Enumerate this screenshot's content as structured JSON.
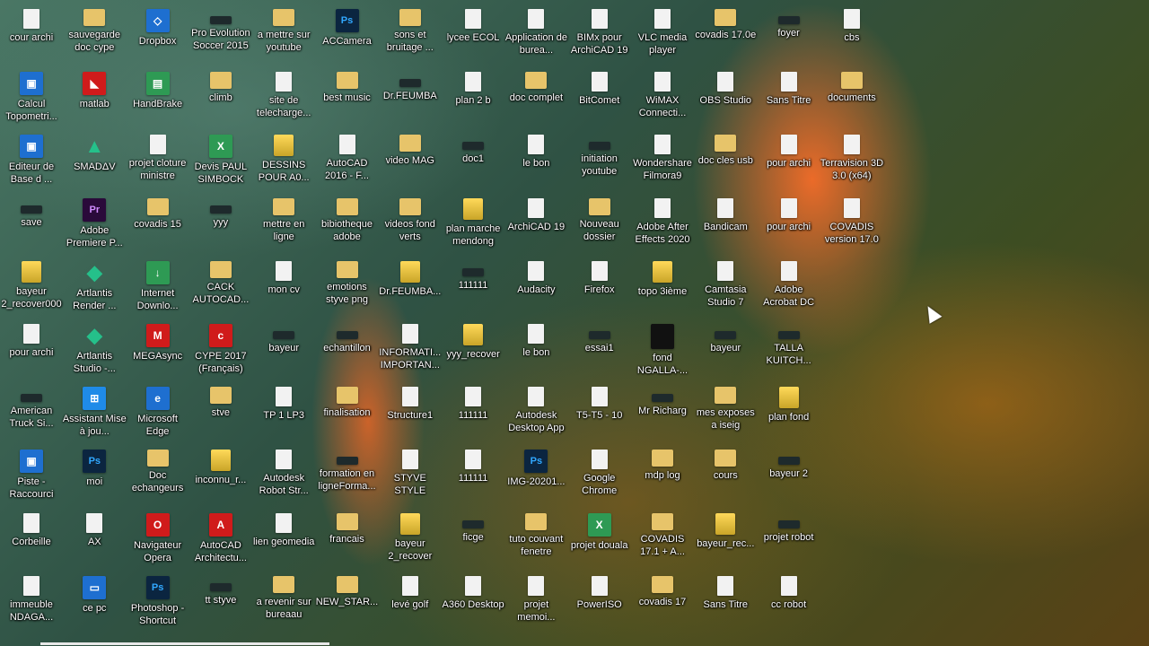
{
  "desktop": {
    "columns": [
      [
        {
          "label": "cour archi",
          "icon": "file-icon"
        },
        {
          "label": "Calcul Topometri...",
          "icon": "app-shortcut-icon"
        },
        {
          "label": "Editeur de Base d ...",
          "icon": "app-shortcut-icon"
        },
        {
          "label": "save",
          "icon": "dark-file-icon"
        },
        {
          "label": "bayeur 2_recover000",
          "icon": "dwg-file-icon"
        },
        {
          "label": "pour archi",
          "icon": "spreadsheet-icon"
        },
        {
          "label": "American Truck Si...",
          "icon": "game-icon"
        },
        {
          "label": "Piste - Raccourci",
          "icon": "app-shortcut-icon"
        },
        {
          "label": "Corbeille",
          "icon": "recycle-bin-icon"
        },
        {
          "label": "immeuble NDAGA...",
          "icon": "file-icon"
        }
      ],
      [
        {
          "label": "sauvegarde doc cype",
          "icon": "folder-icon"
        },
        {
          "label": "matlab",
          "icon": "matlab-icon"
        },
        {
          "label": "SMADΔV",
          "icon": "antivirus-icon"
        },
        {
          "label": "Adobe Premiere P...",
          "icon": "premiere-icon"
        },
        {
          "label": "Artlantis Render ...",
          "icon": "artlantis-icon"
        },
        {
          "label": "Artlantis Studio -...",
          "icon": "artlantis-icon"
        },
        {
          "label": "Assistant Mise à jou...",
          "icon": "windows-icon"
        },
        {
          "label": "moi",
          "icon": "photoshop-icon"
        },
        {
          "label": "AX",
          "icon": "file-icon"
        },
        {
          "label": "ce pc",
          "icon": "computer-icon"
        }
      ],
      [
        {
          "label": "Dropbox",
          "icon": "dropbox-icon"
        },
        {
          "label": "HandBrake",
          "icon": "handbrake-icon"
        },
        {
          "label": "projet cloture ministre",
          "icon": "spreadsheet-icon"
        },
        {
          "label": "covadis 15",
          "icon": "folder-icon"
        },
        {
          "label": "Internet Downlo...",
          "icon": "download-icon"
        },
        {
          "label": "MEGAsync",
          "icon": "mega-icon"
        },
        {
          "label": "Microsoft Edge",
          "icon": "edge-icon"
        },
        {
          "label": "Doc echangeurs",
          "icon": "folder-icon"
        },
        {
          "label": "Navigateur Opera",
          "icon": "opera-icon"
        },
        {
          "label": "Photoshop - Shortcut",
          "icon": "photoshop-icon"
        }
      ],
      [
        {
          "label": "Pro Evolution Soccer 2015",
          "icon": "game-icon"
        },
        {
          "label": "climb",
          "icon": "archive-icon"
        },
        {
          "label": "Devis PAUL SIMBOCK",
          "icon": "excel-icon"
        },
        {
          "label": "yyy",
          "icon": "dark-file-icon"
        },
        {
          "label": "CACK AUTOCAD...",
          "icon": "folder-icon"
        },
        {
          "label": "CYPE 2017 (Français)",
          "icon": "cype-icon"
        },
        {
          "label": "stve",
          "icon": "folder-icon"
        },
        {
          "label": "inconnu_r...",
          "icon": "dwg-file-icon"
        },
        {
          "label": "AutoCAD Architectu...",
          "icon": "autocad-icon"
        },
        {
          "label": "tt styve",
          "icon": "image-icon"
        }
      ],
      [
        {
          "label": "a mettre sur youtube",
          "icon": "folder-icon"
        },
        {
          "label": "site de telecharge...",
          "icon": "file-icon"
        },
        {
          "label": "DESSINS POUR A0...",
          "icon": "dwg-file-icon"
        },
        {
          "label": "mettre en ligne",
          "icon": "folder-icon"
        },
        {
          "label": "mon cv",
          "icon": "file-icon"
        },
        {
          "label": "bayeur",
          "icon": "image-icon"
        },
        {
          "label": "TP 1 LP3",
          "icon": "file-icon"
        },
        {
          "label": "Autodesk Robot Str...",
          "icon": "file-icon"
        },
        {
          "label": "lien geomedia",
          "icon": "file-icon"
        },
        {
          "label": "a revenir sur bureaau",
          "icon": "folder-icon"
        }
      ],
      [
        {
          "label": "ACCamera",
          "icon": "photoshop-icon"
        },
        {
          "label": "best music",
          "icon": "folder-icon"
        },
        {
          "label": "AutoCAD 2016 - F...",
          "icon": "file-icon"
        },
        {
          "label": "bibiotheque adobe",
          "icon": "folder-icon"
        },
        {
          "label": "emotions styve png",
          "icon": "folder-icon"
        },
        {
          "label": "echantillon",
          "icon": "image-icon"
        },
        {
          "label": "finalisation",
          "icon": "folder-icon"
        },
        {
          "label": "formation en ligneForma...",
          "icon": "image-icon"
        },
        {
          "label": "francais",
          "icon": "folder-icon"
        },
        {
          "label": "NEW_STAR...",
          "icon": "folder-icon"
        }
      ],
      [
        {
          "label": "sons et bruitage ...",
          "icon": "folder-icon"
        },
        {
          "label": "Dr.FEUMBA",
          "icon": "dark-file-icon"
        },
        {
          "label": "video MAG",
          "icon": "folder-icon"
        },
        {
          "label": "videos fond verts",
          "icon": "folder-icon"
        },
        {
          "label": "Dr.FEUMBA...",
          "icon": "dwg-file-icon"
        },
        {
          "label": "INFORMATI... IMPORTAN...",
          "icon": "file-icon"
        },
        {
          "label": "Structure1",
          "icon": "file-icon"
        },
        {
          "label": "STYVE STYLE",
          "icon": "file-icon"
        },
        {
          "label": "bayeur 2_recover",
          "icon": "dwg-file-icon"
        },
        {
          "label": "levé golf",
          "icon": "file-icon"
        }
      ],
      [
        {
          "label": "lycee ECOL",
          "icon": "file-icon"
        },
        {
          "label": "plan 2 b",
          "icon": "file-icon"
        },
        {
          "label": "doc1",
          "icon": "dark-file-icon"
        },
        {
          "label": "plan marche mendong",
          "icon": "dwg-file-icon"
        },
        {
          "label": "111111",
          "icon": "dark-file-icon"
        },
        {
          "label": "yyy_recover",
          "icon": "dwg-file-icon"
        },
        {
          "label": "111111",
          "icon": "spreadsheet-icon"
        },
        {
          "label": "111111",
          "icon": "file-icon"
        },
        {
          "label": "ficge",
          "icon": "image-icon"
        },
        {
          "label": "A360 Desktop",
          "icon": "file-icon"
        }
      ],
      [
        {
          "label": "Application de burea...",
          "icon": "file-icon"
        },
        {
          "label": "doc complet",
          "icon": "folder-icon"
        },
        {
          "label": "le bon",
          "icon": "spreadsheet-icon"
        },
        {
          "label": "ArchiCAD 19",
          "icon": "file-icon"
        },
        {
          "label": "Audacity",
          "icon": "file-icon"
        },
        {
          "label": "le bon",
          "icon": "file-icon"
        },
        {
          "label": "Autodesk Desktop App",
          "icon": "file-icon"
        },
        {
          "label": "IMG-20201...",
          "icon": "photoshop-icon"
        },
        {
          "label": "tuto couvant fenetre",
          "icon": "folder-icon"
        },
        {
          "label": "projet memoi...",
          "icon": "file-icon"
        }
      ],
      [
        {
          "label": "BIMx pour ArchiCAD 19",
          "icon": "file-icon"
        },
        {
          "label": "BitComet",
          "icon": "file-icon"
        },
        {
          "label": "initiation youtube",
          "icon": "dark-file-icon"
        },
        {
          "label": "Nouveau dossier",
          "icon": "folder-icon"
        },
        {
          "label": "Firefox",
          "icon": "file-icon"
        },
        {
          "label": "essai1",
          "icon": "dark-file-icon"
        },
        {
          "label": "T5-T5 - 10",
          "icon": "file-icon"
        },
        {
          "label": "Google Chrome",
          "icon": "file-icon"
        },
        {
          "label": "projet douala",
          "icon": "excel-icon"
        },
        {
          "label": "PowerISO",
          "icon": "file-icon"
        }
      ],
      [
        {
          "label": "VLC media player",
          "icon": "file-icon"
        },
        {
          "label": "WiMAX Connecti...",
          "icon": "file-icon"
        },
        {
          "label": "Wondershare Filmora9",
          "icon": "file-icon"
        },
        {
          "label": "Adobe After Effects 2020",
          "icon": "file-icon"
        },
        {
          "label": "topo 3ième",
          "icon": "dwg-file-icon"
        },
        {
          "label": "fond NGALLA-...",
          "icon": "black-image-icon"
        },
        {
          "label": "Mr Richarg",
          "icon": "dark-file-icon"
        },
        {
          "label": "mdp log",
          "icon": "folder-icon"
        },
        {
          "label": "COVADIS 17.1 + A...",
          "icon": "archive-icon"
        },
        {
          "label": "covadis 17",
          "icon": "folder-icon"
        }
      ],
      [
        {
          "label": "covadis 17.0e",
          "icon": "folder-icon"
        },
        {
          "label": "OBS Studio",
          "icon": "file-icon"
        },
        {
          "label": "doc cles usb",
          "icon": "folder-icon"
        },
        {
          "label": "Bandicam",
          "icon": "file-icon"
        },
        {
          "label": "Camtasia Studio 7",
          "icon": "file-icon"
        },
        {
          "label": "bayeur",
          "icon": "image-icon"
        },
        {
          "label": "mes exposes a iseig",
          "icon": "folder-icon"
        },
        {
          "label": "cours",
          "icon": "folder-icon"
        },
        {
          "label": "bayeur_rec...",
          "icon": "dwg-file-icon"
        },
        {
          "label": "Sans Titre",
          "icon": "spreadsheet-icon"
        }
      ],
      [
        {
          "label": "foyer",
          "icon": "dark-file-icon"
        },
        {
          "label": "Sans Titre",
          "icon": "file-icon"
        },
        {
          "label": "pour archi",
          "icon": "file-icon"
        },
        {
          "label": "pour archi",
          "icon": "file-icon"
        },
        {
          "label": "Adobe Acrobat DC",
          "icon": "file-icon"
        },
        {
          "label": "TALLA KUITCH...",
          "icon": "image-icon"
        },
        {
          "label": "plan fond",
          "icon": "dwg-file-icon"
        },
        {
          "label": "bayeur 2",
          "icon": "dark-file-icon"
        },
        {
          "label": "projet robot",
          "icon": "image-icon"
        },
        {
          "label": "cc robot",
          "icon": "file-icon"
        }
      ],
      [
        {
          "label": "cbs",
          "icon": "file-icon"
        },
        {
          "label": "documents",
          "icon": "folder-icon"
        },
        {
          "label": "Terravision 3D 3.0 (x64)",
          "icon": "file-icon"
        },
        {
          "label": "COVADIS version 17.0",
          "icon": "file-icon"
        }
      ]
    ]
  }
}
